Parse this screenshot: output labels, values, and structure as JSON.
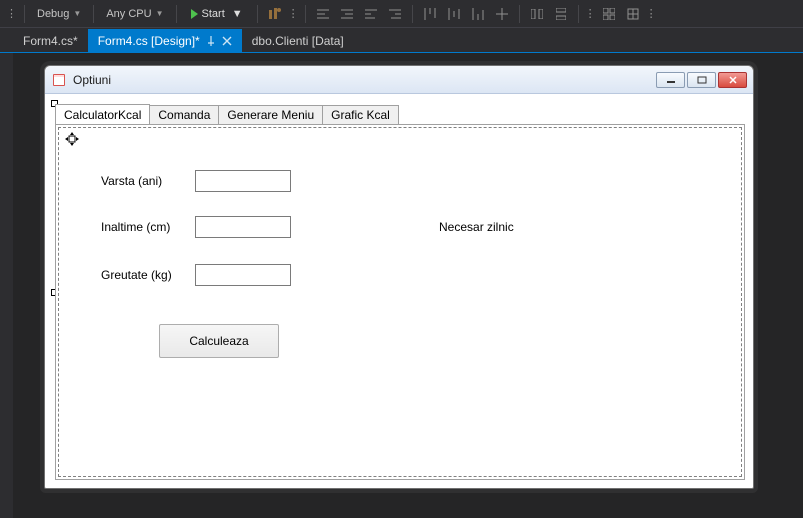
{
  "toolbar": {
    "config": "Debug",
    "platform": "Any CPU",
    "start": "Start"
  },
  "tabs": {
    "t1": "Form4.cs*",
    "t2": "Form4.cs [Design]*",
    "t3": "dbo.Clienti [Data]"
  },
  "form": {
    "title": "Optiuni",
    "tabs": {
      "calc": "CalculatorKcal",
      "comanda": "Comanda",
      "gen": "Generare Meniu",
      "grafic": "Grafic Kcal"
    },
    "labels": {
      "varsta": "Varsta (ani)",
      "inaltime": "Inaltime (cm)",
      "greutate": "Greutate (kg)",
      "necesar": "Necesar zilnic"
    },
    "buttons": {
      "calc": "Calculeaza"
    }
  }
}
